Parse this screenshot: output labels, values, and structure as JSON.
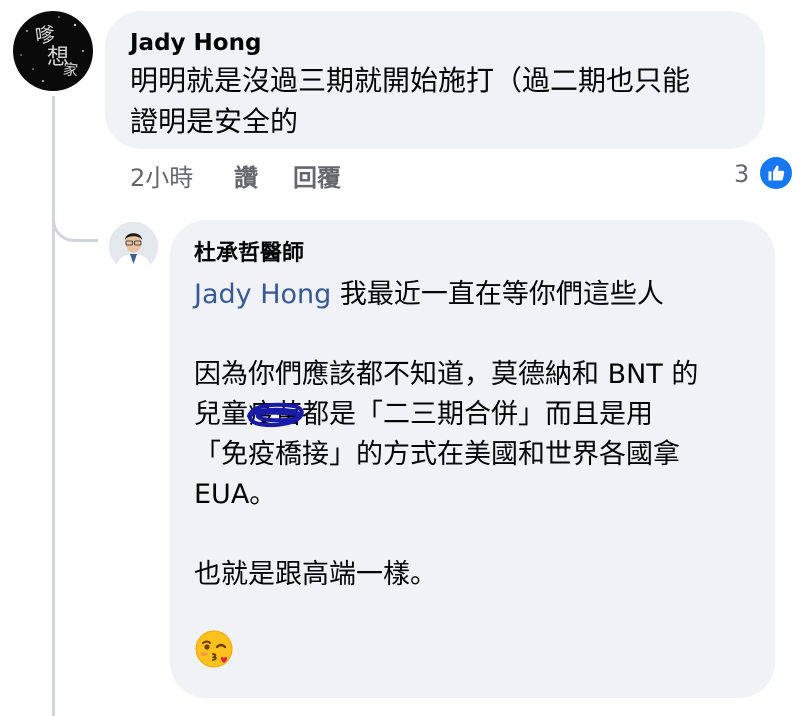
{
  "comment": {
    "author": "Jady Hong",
    "text_line1": "明明就是沒過三期就開始施打（過二期也只能",
    "text_line2": "證明是安全的",
    "time": "2小時",
    "like_label": "讚",
    "reply_label": "回覆",
    "reaction_count": "3",
    "reaction_icon": "thumbs-up-icon",
    "avatar_glyphs": [
      "嗲",
      "想",
      "家"
    ]
  },
  "reply": {
    "author": "杜承哲醫師",
    "mention": "Jady Hong",
    "line1_rest": " 我最近一直在等你們這些人",
    "para2_line1": "因為你們應該都不知道，莫德納和 BNT 的",
    "para2_line2_a": "兒童",
    "para2_scribbled": "疫苗",
    "para2_line2_b": "都是「二三期合併」而且是用",
    "para2_line3": "「免疫橋接」的方式在美國和世界各國拿",
    "para2_line4": "EUA。",
    "para3": "也就是跟高端一樣。",
    "emoji": "kissing-face-with-heart-emoji"
  },
  "colors": {
    "bubble": "#f0f2f5",
    "mention": "#385898",
    "meta": "#65676b",
    "like_blue": "#1877f2",
    "scribble": "#1a1aa8"
  }
}
